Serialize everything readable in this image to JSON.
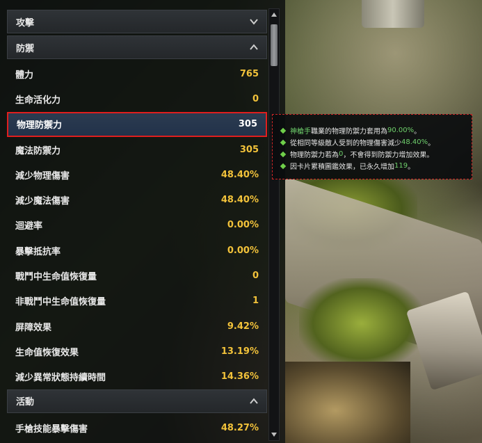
{
  "sections": {
    "attack": {
      "label": "攻擊",
      "chevron": "chevron-down-icon"
    },
    "defense": {
      "label": "防禦",
      "chevron": "chevron-up-icon"
    },
    "activity": {
      "label": "活動",
      "chevron": "chevron-up-icon"
    }
  },
  "defense_stats": [
    {
      "label": "體力",
      "value": "765"
    },
    {
      "label": "生命活化力",
      "value": "0"
    },
    {
      "label": "物理防禦力",
      "value": "305"
    },
    {
      "label": "魔法防禦力",
      "value": "305"
    },
    {
      "label": "減少物理傷害",
      "value": "48.40%"
    },
    {
      "label": "減少魔法傷害",
      "value": "48.40%"
    },
    {
      "label": "迴避率",
      "value": "0.00%"
    },
    {
      "label": "暴擊抵抗率",
      "value": "0.00%"
    },
    {
      "label": "戰鬥中生命值恢復量",
      "value": "0"
    },
    {
      "label": "非戰鬥中生命值恢復量",
      "value": "1"
    },
    {
      "label": "屏障效果",
      "value": "9.42%"
    },
    {
      "label": "生命值恢復效果",
      "value": "13.19%"
    },
    {
      "label": "減少異常狀態持續時間",
      "value": "14.36%"
    }
  ],
  "activity_stats": [
    {
      "label": "手槍技能暴擊傷害",
      "value": "48.27%"
    }
  ],
  "tooltip": {
    "line1": {
      "a": "神槍手",
      "b": "職業的物理防禦力套用為",
      "c": "90.00%",
      "d": "。"
    },
    "line2": {
      "a": "從相同等級敵人受到的物理傷害減少",
      "b": "48.40%",
      "c": "。"
    },
    "line3": {
      "a": "物理防禦力若為",
      "b": "0",
      "c": "，不會得到防禦力增加效果。"
    },
    "line4": {
      "a": "因卡片累積圖鑑效果，已永久增加",
      "b": "119",
      "c": "。"
    }
  },
  "colors": {
    "value_gold": "#f2c23a",
    "highlight_border": "#e01e1e",
    "tooltip_accent": "#6fd06c"
  }
}
